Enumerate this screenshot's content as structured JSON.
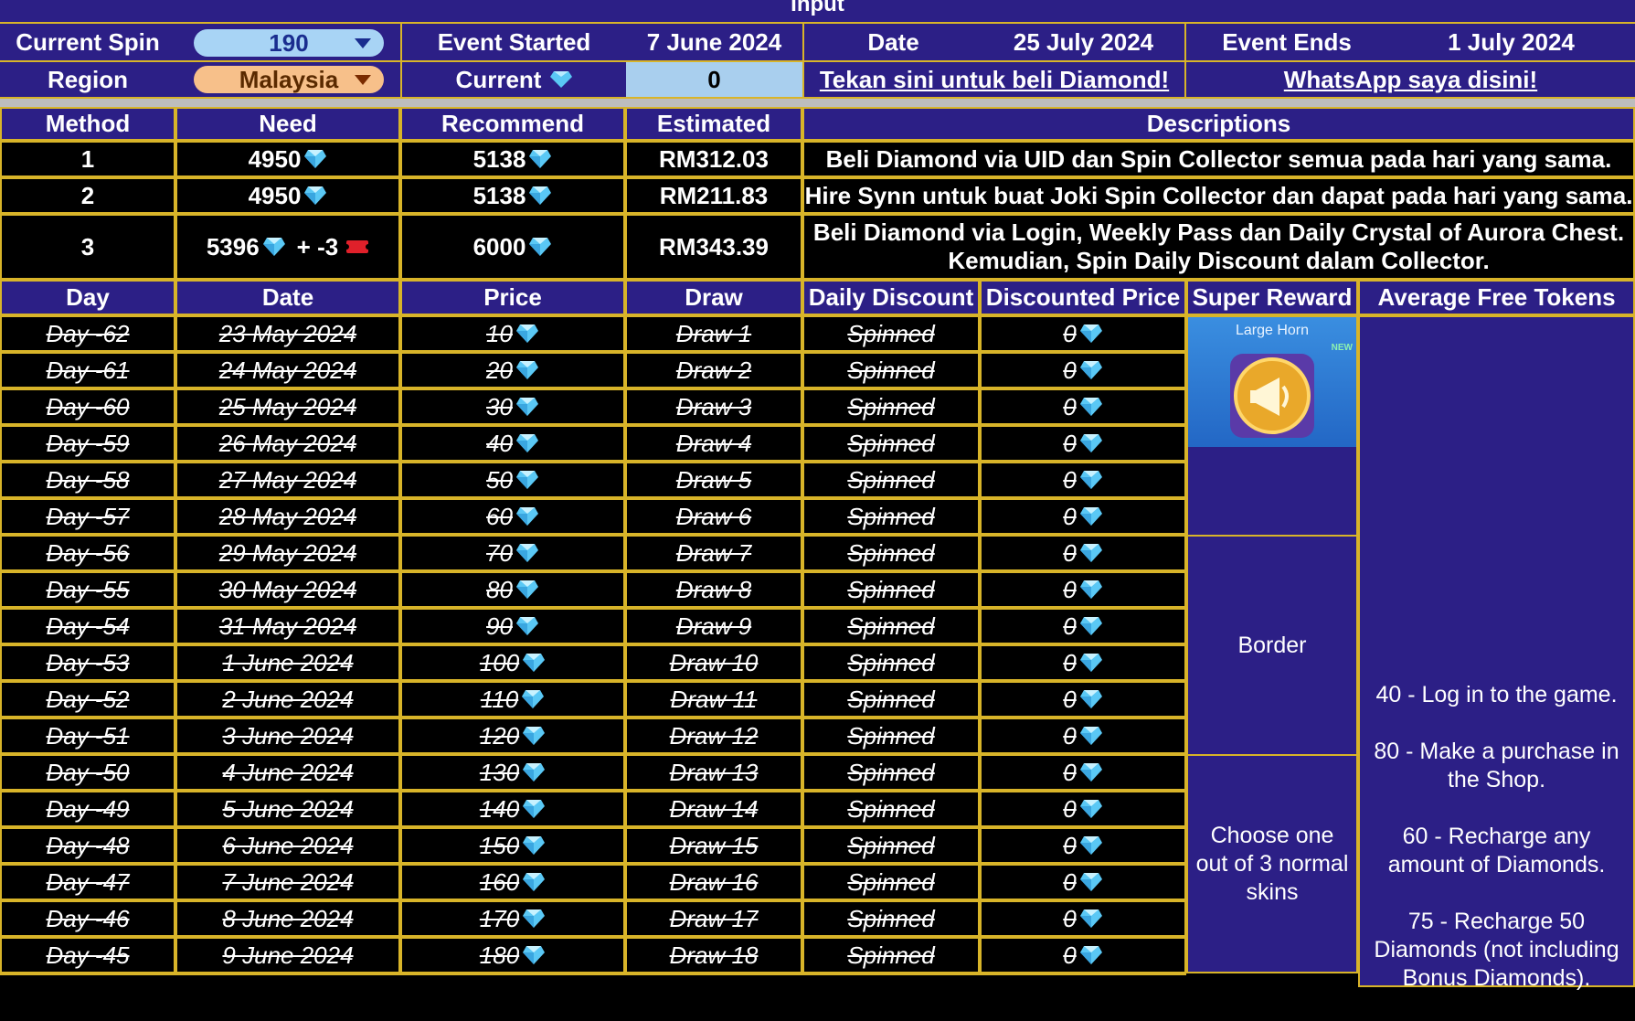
{
  "top_title": "Input",
  "input_panel": {
    "current_spin_label": "Current Spin",
    "current_spin_value": "190",
    "region_label": "Region",
    "region_value": "Malaysia",
    "event_started_label": "Event Started",
    "event_started_value": "7 June 2024",
    "current_label": "Current",
    "current_value": "0",
    "date_label": "Date",
    "date_value": "25 July 2024",
    "event_ends_label": "Event Ends",
    "event_ends_value": "1 July 2024",
    "buy_link": "Tekan sini untuk beli Diamond!",
    "whatsapp_link": "WhatsApp saya disini!"
  },
  "methods": {
    "headers": [
      "Method",
      "Need",
      "Recommend",
      "Estimated",
      "Descriptions"
    ],
    "rows": [
      {
        "method": "1",
        "need": "4950",
        "need_extra": "",
        "recommend": "5138",
        "estimated": "RM312.03",
        "description": "Beli Diamond via UID dan Spin Collector semua pada hari yang sama."
      },
      {
        "method": "2",
        "need": "4950",
        "need_extra": "",
        "recommend": "5138",
        "estimated": "RM211.83",
        "description": "Hire Synn untuk buat Joki Spin Collector dan dapat pada hari yang sama."
      },
      {
        "method": "3",
        "need": "5396",
        "need_extra": "+ -3",
        "recommend": "6000",
        "estimated": "RM343.39",
        "description_line1": "Beli Diamond via Login, Weekly Pass dan Daily Crystal of Aurora Chest.",
        "description_line2": "Kemudian, Spin Daily Discount dalam Collector."
      }
    ]
  },
  "schedule": {
    "headers": [
      "Day",
      "Date",
      "Price",
      "Draw",
      "Daily Discount",
      "Discounted Price",
      "Super Reward",
      "Average Free Tokens"
    ],
    "rows": [
      {
        "day": "Day -62",
        "date": "23 May 2024",
        "price": "10",
        "draw": "Draw 1",
        "discount": "Spinned",
        "discounted": "0"
      },
      {
        "day": "Day -61",
        "date": "24 May 2024",
        "price": "20",
        "draw": "Draw 2",
        "discount": "Spinned",
        "discounted": "0"
      },
      {
        "day": "Day -60",
        "date": "25 May 2024",
        "price": "30",
        "draw": "Draw 3",
        "discount": "Spinned",
        "discounted": "0"
      },
      {
        "day": "Day -59",
        "date": "26 May 2024",
        "price": "40",
        "draw": "Draw 4",
        "discount": "Spinned",
        "discounted": "0"
      },
      {
        "day": "Day -58",
        "date": "27 May 2024",
        "price": "50",
        "draw": "Draw 5",
        "discount": "Spinned",
        "discounted": "0"
      },
      {
        "day": "Day -57",
        "date": "28 May 2024",
        "price": "60",
        "draw": "Draw 6",
        "discount": "Spinned",
        "discounted": "0"
      },
      {
        "day": "Day -56",
        "date": "29 May 2024",
        "price": "70",
        "draw": "Draw 7",
        "discount": "Spinned",
        "discounted": "0"
      },
      {
        "day": "Day -55",
        "date": "30 May 2024",
        "price": "80",
        "draw": "Draw 8",
        "discount": "Spinned",
        "discounted": "0"
      },
      {
        "day": "Day -54",
        "date": "31 May 2024",
        "price": "90",
        "draw": "Draw 9",
        "discount": "Spinned",
        "discounted": "0"
      },
      {
        "day": "Day -53",
        "date": "1 June 2024",
        "price": "100",
        "draw": "Draw 10",
        "discount": "Spinned",
        "discounted": "0"
      },
      {
        "day": "Day -52",
        "date": "2 June 2024",
        "price": "110",
        "draw": "Draw 11",
        "discount": "Spinned",
        "discounted": "0"
      },
      {
        "day": "Day -51",
        "date": "3 June 2024",
        "price": "120",
        "draw": "Draw 12",
        "discount": "Spinned",
        "discounted": "0"
      },
      {
        "day": "Day -50",
        "date": "4 June 2024",
        "price": "130",
        "draw": "Draw 13",
        "discount": "Spinned",
        "discounted": "0"
      },
      {
        "day": "Day -49",
        "date": "5 June 2024",
        "price": "140",
        "draw": "Draw 14",
        "discount": "Spinned",
        "discounted": "0"
      },
      {
        "day": "Day -48",
        "date": "6 June 2024",
        "price": "150",
        "draw": "Draw 15",
        "discount": "Spinned",
        "discounted": "0"
      },
      {
        "day": "Day -47",
        "date": "7 June 2024",
        "price": "160",
        "draw": "Draw 16",
        "discount": "Spinned",
        "discounted": "0"
      },
      {
        "day": "Day -46",
        "date": "8 June 2024",
        "price": "170",
        "draw": "Draw 17",
        "discount": "Spinned",
        "discounted": "0"
      },
      {
        "day": "Day -45",
        "date": "9 June 2024",
        "price": "180",
        "draw": "Draw 18",
        "discount": "Spinned",
        "discounted": "0"
      }
    ],
    "super_rewards": {
      "reward1_title": "Large Horn",
      "reward1_badge": "NEW",
      "reward2": "Border",
      "reward3": "Choose one out of 3 normal skins"
    },
    "free_tokens": [
      "40 - Log in to the game.",
      "80 - Make a purchase in the Shop.",
      "60 - Recharge any amount of Diamonds.",
      "75 - Recharge 50 Diamonds (not including Bonus Diamonds)."
    ]
  },
  "colors": {
    "header_bg": "#2c1f86",
    "border_gold": "#d8b429",
    "spin_pill": "#a8d4f5",
    "region_pill": "#f7c08a",
    "current_input": "#a9cfee",
    "diamond": "#5ac8f5",
    "ticket_red": "#e0202a"
  },
  "icons": [
    "diamond-icon",
    "ticket-icon",
    "dropdown-caret-icon",
    "horn-icon"
  ]
}
